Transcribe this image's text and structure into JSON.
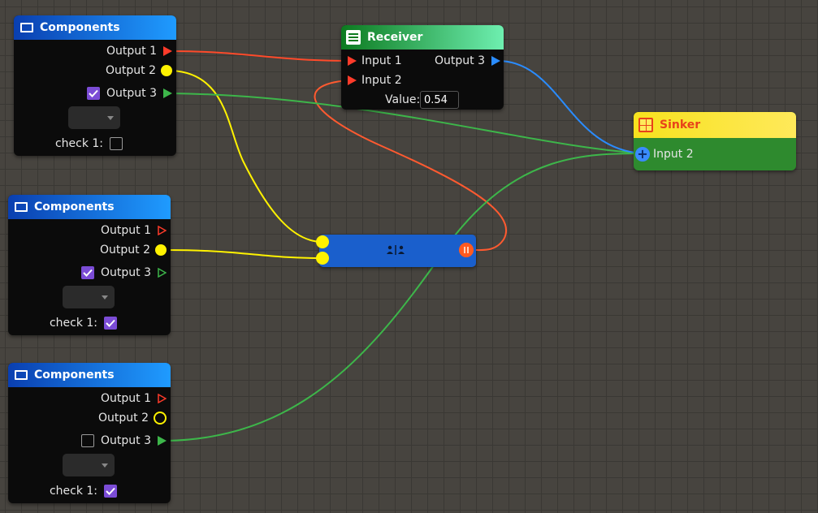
{
  "nodes": {
    "components_1": {
      "title": "Components",
      "outputs": [
        "Output 1",
        "Output 2",
        "Output 3"
      ],
      "output3_checked": true,
      "check_label": "check 1:",
      "check_checked": false
    },
    "components_2": {
      "title": "Components",
      "outputs": [
        "Output 1",
        "Output 2",
        "Output 3"
      ],
      "output3_checked": true,
      "check_label": "check 1:",
      "check_checked": true
    },
    "components_3": {
      "title": "Components",
      "outputs": [
        "Output 1",
        "Output 2",
        "Output 3"
      ],
      "output3_checked": false,
      "check_label": "check 1:",
      "check_checked": true
    },
    "receiver": {
      "title": "Receiver",
      "inputs": [
        "Input 1",
        "Input 2"
      ],
      "output": "Output 3",
      "value_label": "Value:",
      "value": "0.54"
    },
    "sinker": {
      "title": "Sinker",
      "input": "Input 2"
    },
    "splitter": {
      "icon": "person-split-icon"
    }
  },
  "colors": {
    "red": "#ff4a2a",
    "yellow": "#fff200",
    "green": "#3db64a",
    "blue": "#2a8cff",
    "node_bg": "#0b0b0b",
    "canvas_bg": "#47443f"
  }
}
